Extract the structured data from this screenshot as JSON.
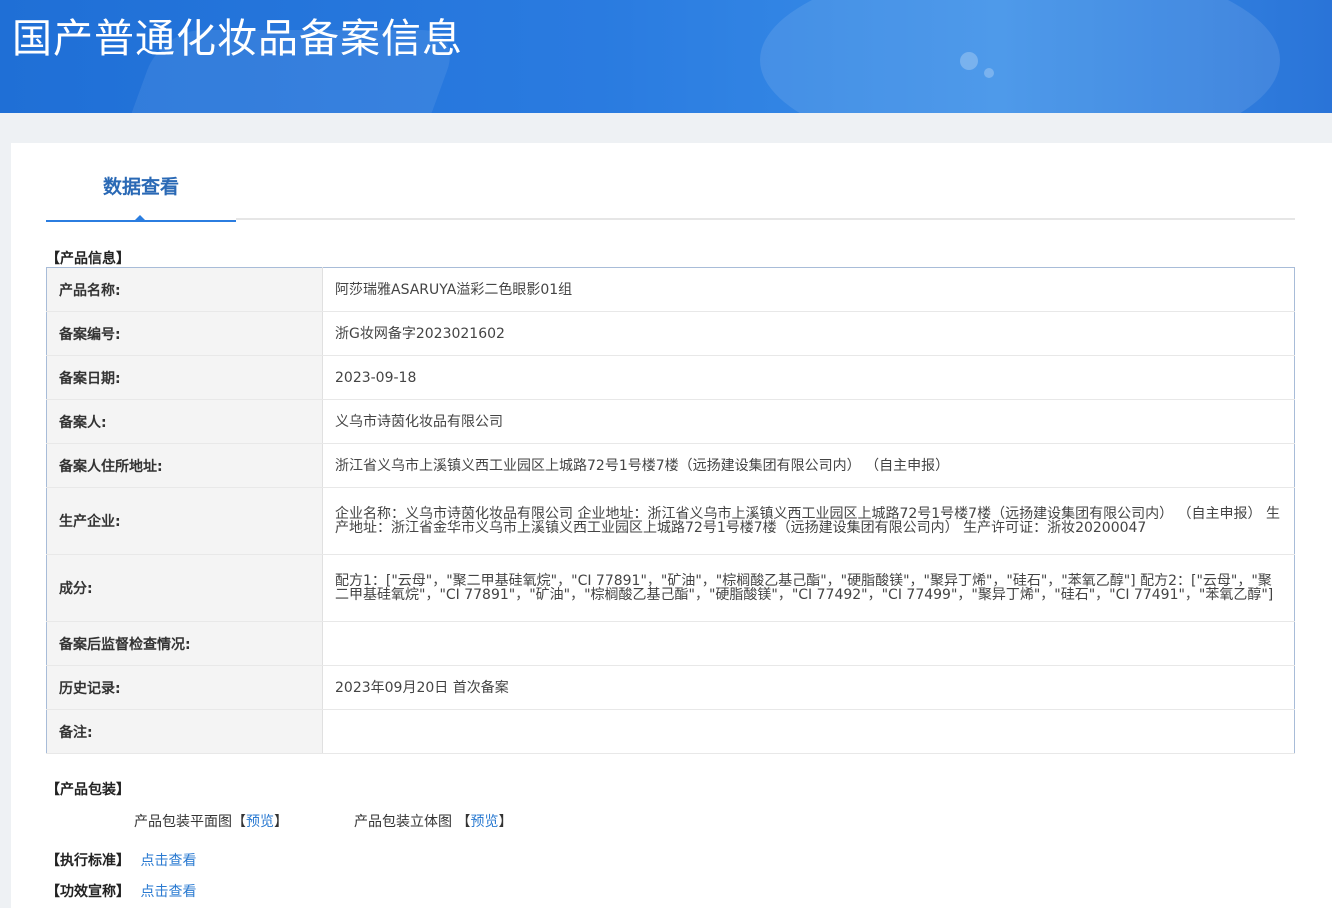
{
  "header": {
    "title": "国产普通化妆品备案信息"
  },
  "tab": {
    "label": "数据查看"
  },
  "product_info": {
    "section_label": "【产品信息】",
    "rows": [
      {
        "key": "产品名称:",
        "value": "阿莎瑞雅ASARUYA溢彩二色眼影01组"
      },
      {
        "key": "备案编号:",
        "value": "浙G妆网备字2023021602"
      },
      {
        "key": "备案日期:",
        "value": "2023-09-18"
      },
      {
        "key": "备案人:",
        "value": "义乌市诗茵化妆品有限公司"
      },
      {
        "key": "备案人住所地址:",
        "value": "浙江省义乌市上溪镇义西工业园区上城路72号1号楼7楼（远扬建设集团有限公司内） （自主申报）"
      },
      {
        "key": "生产企业:",
        "value": "企业名称：义乌市诗茵化妆品有限公司 企业地址：浙江省义乌市上溪镇义西工业园区上城路72号1号楼7楼（远扬建设集团有限公司内） （自主申报） 生产地址：浙江省金华市义乌市上溪镇义西工业园区上城路72号1号楼7楼（远扬建设集团有限公司内） 生产许可证：浙妆20200047"
      },
      {
        "key": "成分:",
        "value": "配方1：[\"云母\"，\"聚二甲基硅氧烷\"，\"CI 77891\"，\"矿油\"，\"棕榈酸乙基己酯\"，\"硬脂酸镁\"，\"聚异丁烯\"，\"硅石\"，\"苯氧乙醇\"] 配方2：[\"云母\"，\"聚二甲基硅氧烷\"，\"CI 77891\"，\"矿油\"，\"棕榈酸乙基己酯\"，\"硬脂酸镁\"，\"CI 77492\"，\"CI 77499\"，\"聚异丁烯\"，\"硅石\"，\"CI 77491\"，\"苯氧乙醇\"]"
      },
      {
        "key": "备案后监督检查情况:",
        "value": ""
      },
      {
        "key": "历史记录:",
        "value": "2023年09月20日 首次备案"
      },
      {
        "key": "备注:",
        "value": ""
      }
    ]
  },
  "packaging": {
    "section_label": "【产品包装】",
    "flat_label": "产品包装平面图",
    "solid_label": "产品包装立体图",
    "bracket_open": "【",
    "bracket_close": "】",
    "preview_link": "预览"
  },
  "standard": {
    "label": "【执行标准】",
    "link": "点击查看"
  },
  "efficacy": {
    "label": "【功效宣称】",
    "link": "点击查看"
  }
}
